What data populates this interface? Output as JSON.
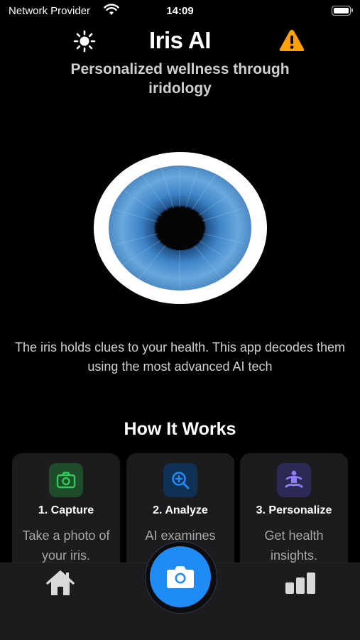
{
  "status_bar": {
    "carrier": "Network Provider",
    "time": "14:09"
  },
  "header": {
    "title": "Iris AI",
    "subtitle": "Personalized wellness through iridology",
    "left_icon": "sun-icon",
    "right_icon": "warning-icon"
  },
  "hero": {
    "tagline": "The iris holds clues to your health. This app decodes them using the most advanced AI tech"
  },
  "how_it_works": {
    "title": "How It Works",
    "steps": [
      {
        "title": "1. Capture",
        "description": "Take a photo of your iris.",
        "icon": "camera-icon",
        "icon_bg": "#1f4d2b",
        "icon_color": "#34c759"
      },
      {
        "title": "2. Analyze",
        "description": "AI examines patterns.",
        "icon": "magnifier-plus-icon",
        "icon_bg": "#0f3254",
        "icon_color": "#1f8cf5"
      },
      {
        "title": "3. Personalize",
        "description": "Get health insights.",
        "icon": "meditation-icon",
        "icon_bg": "#2c2a55",
        "icon_color": "#8e7cf5"
      }
    ]
  },
  "tab_bar": {
    "left": "home-icon",
    "center": "camera-icon",
    "right": "stats-icon",
    "accent": "#1f8cf5"
  }
}
